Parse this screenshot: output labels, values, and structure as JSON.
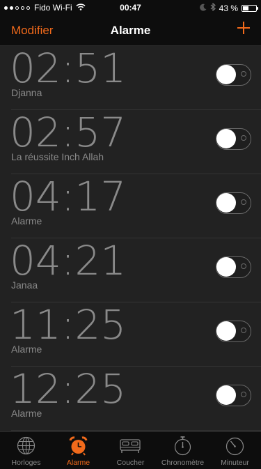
{
  "status_bar": {
    "carrier": "Fido Wi-Fi",
    "time": "00:47",
    "battery_percent": "43 %",
    "battery_level": 0.43,
    "icons": [
      "signal-dots-icon",
      "wifi-icon",
      "moon-icon",
      "bluetooth-icon",
      "battery-icon"
    ]
  },
  "nav": {
    "edit_label": "Modifier",
    "title": "Alarme",
    "add_label": "+"
  },
  "alarms": [
    {
      "time": "02:51",
      "label": "Djanna",
      "enabled": false
    },
    {
      "time": "02:57",
      "label": "La réussite Inch Allah",
      "enabled": false
    },
    {
      "time": "04:17",
      "label": "Alarme",
      "enabled": false
    },
    {
      "time": "04:21",
      "label": "Janaa",
      "enabled": false
    },
    {
      "time": "11:25",
      "label": "Alarme",
      "enabled": false
    },
    {
      "time": "12:25",
      "label": "Alarme",
      "enabled": false
    }
  ],
  "tabs": [
    {
      "label": "Horloges",
      "icon": "globe-icon",
      "active": false
    },
    {
      "label": "Alarme",
      "icon": "alarm-clock-icon",
      "active": true
    },
    {
      "label": "Coucher",
      "icon": "bed-icon",
      "active": false
    },
    {
      "label": "Chronomètre",
      "icon": "stopwatch-icon",
      "active": false
    },
    {
      "label": "Minuteur",
      "icon": "timer-icon",
      "active": false
    }
  ],
  "colors": {
    "accent": "#f26a1b",
    "background": "#222222",
    "bar_background": "#0d0d0d",
    "text_secondary": "#8a8a8a"
  }
}
